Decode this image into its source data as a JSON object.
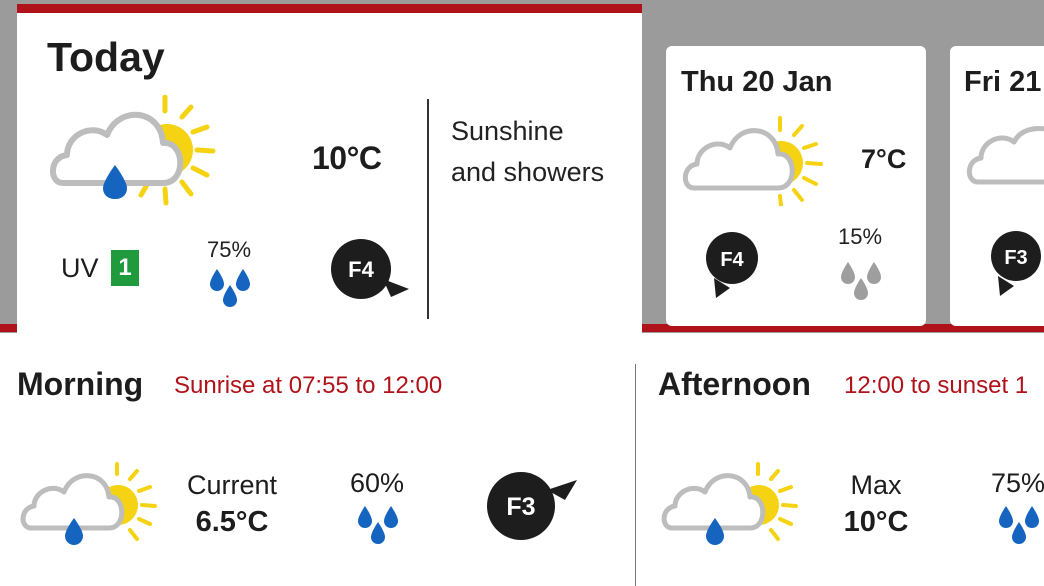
{
  "today": {
    "title": "Today",
    "temperature": "10°C",
    "description_line1": "Sunshine",
    "description_line2": "and showers",
    "uv_label": "UV",
    "uv_value": "1",
    "rain_chance": "75%",
    "wind": "F4",
    "icon": "sun-cloud-rain-icon"
  },
  "forecast_days": [
    {
      "title": "Thu 20 Jan",
      "temperature": "7°C",
      "wind": "F4",
      "rain_chance": "15%",
      "icon": "sun-cloud-icon"
    },
    {
      "title": "Fri 21",
      "wind": "F3",
      "icon": "cloud-icon"
    }
  ],
  "morning": {
    "title": "Morning",
    "subtitle": "Sunrise at 07:55 to 12:00",
    "temp_label": "Current",
    "temperature": "6.5°C",
    "rain_chance": "60%",
    "wind": "F3"
  },
  "afternoon": {
    "title": "Afternoon",
    "subtitle": "12:00 to sunset 1",
    "temp_label": "Max",
    "temperature": "10°C",
    "rain_chance": "75%"
  },
  "colors": {
    "accent_red": "#b0121a",
    "uv_green": "#1f9a3c",
    "rain_blue": "#1565c0",
    "rain_grey": "#9e9e9e",
    "sun_yellow": "#f5d312",
    "background_grey": "#9b9b9b"
  }
}
